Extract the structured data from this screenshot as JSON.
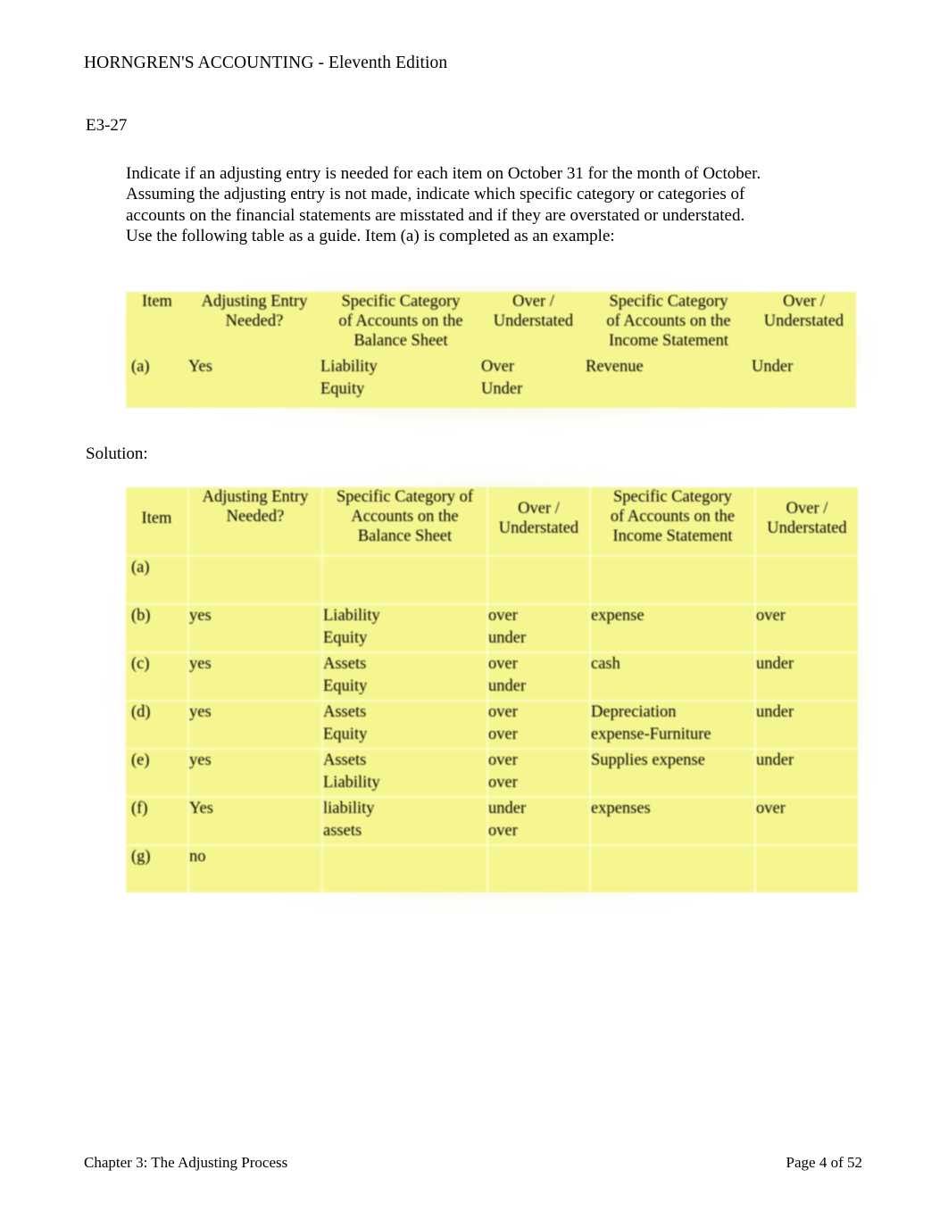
{
  "document": {
    "header_title": "HORNGREN'S ACCOUNTING - Eleventh Edition",
    "exercise_number": "E3-27",
    "instructions": "Indicate if an adjusting entry is needed for each item on October 31 for the month of October. Assuming the adjusting entry is not made, indicate which specific category or categories of accounts on the financial statements are misstated and if they are overstated or understated. Use the following table as a guide. Item (a) is completed as an example:",
    "solution_label": "Solution:",
    "footer_left": "Chapter 3: The Adjusting Process",
    "footer_right": "Page 4 of 52",
    "table_fill_color": "#f6f691"
  },
  "example_table": {
    "headers": {
      "item": "Item",
      "adjusting_entry": [
        "Adjusting Entry",
        "Needed?"
      ],
      "balance_sheet_category": [
        "Specific Category",
        "of Accounts on the",
        "Balance Sheet"
      ],
      "over_under_bs": [
        "Over /",
        "Understated"
      ],
      "income_statement_category": [
        "Specific Category",
        "of Accounts on the",
        "Income Statement"
      ],
      "over_under_is": [
        "Over /",
        "Understated"
      ]
    },
    "rows": [
      {
        "item": "(a)",
        "adjusting_entry": "Yes",
        "bs_category_line1": "Liability",
        "bs_category_line2": "Equity",
        "bs_over_under_line1": "Over",
        "bs_over_under_line2": "Under",
        "is_category_line1": "Revenue",
        "is_category_line2": "",
        "is_over_under_line1": "Under",
        "is_over_under_line2": ""
      }
    ]
  },
  "solution_table": {
    "headers": {
      "item": "Item",
      "adjusting_entry": [
        "Adjusting Entry",
        "Needed?"
      ],
      "balance_sheet_category": [
        "Specific Category of",
        "Accounts on the",
        "Balance Sheet"
      ],
      "over_under_bs": [
        "Over /",
        "Understated"
      ],
      "income_statement_category": [
        "Specific Category",
        "of Accounts on the",
        "Income Statement"
      ],
      "over_under_is": [
        "Over /",
        "Understated"
      ]
    },
    "rows": [
      {
        "item": "(a)",
        "adjusting_entry": "",
        "bs_category_line1": "",
        "bs_category_line2": "",
        "bs_over_under_line1": "",
        "bs_over_under_line2": "",
        "is_category_line1": "",
        "is_category_line2": "",
        "is_over_under_line1": "",
        "is_over_under_line2": ""
      },
      {
        "item": "(b)",
        "adjusting_entry": "yes",
        "bs_category_line1": "Liability",
        "bs_category_line2": "Equity",
        "bs_over_under_line1": "over",
        "bs_over_under_line2": "under",
        "is_category_line1": "expense",
        "is_category_line2": "",
        "is_over_under_line1": "over",
        "is_over_under_line2": ""
      },
      {
        "item": "(c)",
        "adjusting_entry": "yes",
        "bs_category_line1": "Assets",
        "bs_category_line2": "Equity",
        "bs_over_under_line1": "over",
        "bs_over_under_line2": "under",
        "is_category_line1": "cash",
        "is_category_line2": "",
        "is_over_under_line1": "under",
        "is_over_under_line2": ""
      },
      {
        "item": "(d)",
        "adjusting_entry": "yes",
        "bs_category_line1": "Assets",
        "bs_category_line2": "Equity",
        "bs_over_under_line1": "over",
        "bs_over_under_line2": "over",
        "is_category_line1": "Depreciation",
        "is_category_line2": "expense-Furniture",
        "is_over_under_line1": "under",
        "is_over_under_line2": ""
      },
      {
        "item": "(e)",
        "adjusting_entry": "yes",
        "bs_category_line1": "Assets",
        "bs_category_line2": "Liability",
        "bs_over_under_line1": "over",
        "bs_over_under_line2": "over",
        "is_category_line1": "Supplies expense",
        "is_category_line2": "",
        "is_over_under_line1": "under",
        "is_over_under_line2": ""
      },
      {
        "item": "(f)",
        "adjusting_entry": "Yes",
        "bs_category_line1": "liability",
        "bs_category_line2": "assets",
        "bs_over_under_line1": "under",
        "bs_over_under_line2": "over",
        "is_category_line1": "expenses",
        "is_category_line2": "",
        "is_over_under_line1": "over",
        "is_over_under_line2": ""
      },
      {
        "item": "(g)",
        "adjusting_entry": "no",
        "bs_category_line1": "",
        "bs_category_line2": "",
        "bs_over_under_line1": "",
        "bs_over_under_line2": "",
        "is_category_line1": "",
        "is_category_line2": "",
        "is_over_under_line1": "",
        "is_over_under_line2": ""
      }
    ]
  }
}
